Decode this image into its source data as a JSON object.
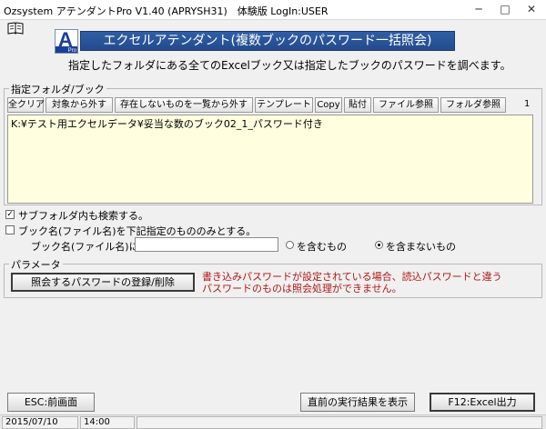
{
  "window": {
    "title": "Ozsystem アテンダントPro V1.40 (APRYSH31)　体験版 LogIn:USER",
    "minimize": "─",
    "maximize": "□",
    "close": "✕"
  },
  "header": {
    "logo_letter": "A",
    "logo_caption": "Pro",
    "banner": "エクセルアテンダント(複数ブックのパスワード一括照会)",
    "subtitle": "指定したフォルダにある全てのExcelブック又は指定したブックのパスワードを調べます。"
  },
  "folder_section": {
    "label": "指定フォルダ/ブック",
    "toolbar": [
      "全クリア",
      "対象から外す",
      "存在しないものを一覧から外す",
      "テンプレート",
      "Copy",
      "貼付",
      "ファイル参照",
      "フォルダ参照"
    ],
    "count": "1",
    "paths": [
      "K:¥テスト用エクセルデータ¥妥当な数のブック02_1_パスワード付き"
    ]
  },
  "options": {
    "subfolder_label": "サブフォルダ内も検索する。",
    "subfolder_checked": true,
    "bookname_label": "ブック名(ファイル名)を下記指定のもののみとする。",
    "bookname_checked": false,
    "name_prefix": "ブック名(ファイル名)に",
    "name_value": "",
    "include_label": "を含むもの",
    "exclude_label": "を含まないもの",
    "selected": "exclude"
  },
  "params": {
    "label": "パラメータ",
    "register_button": "照会するパスワードの登録/削除",
    "warning_lines": [
      "書き込みパスワードが設定されている場合、読込パスワードと違う",
      "パスワードのものは照会処理ができません。"
    ]
  },
  "footer": {
    "esc_button": "ESC:前画面",
    "prev_result_button": "直前の実行結果を表示",
    "f12_button": "F12:Excel出力"
  },
  "status": {
    "date": "2015/07/10",
    "time": "14:00"
  },
  "colors": {
    "banner": "#2f5ea6",
    "path_bg": "#ffffdf",
    "warning": "#b01818"
  }
}
